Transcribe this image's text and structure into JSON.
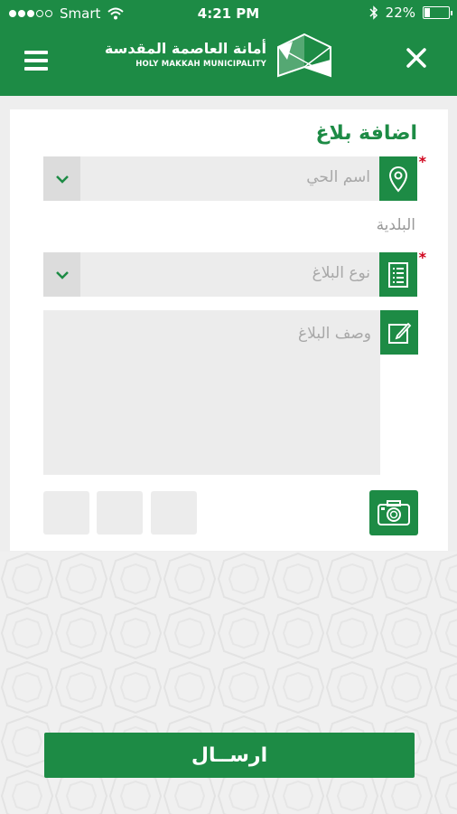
{
  "status_bar": {
    "carrier": "Smart",
    "time": "4:21 PM",
    "battery": "22%",
    "battery_level": 0.22
  },
  "header": {
    "logo_arabic": "أمانة العاصمة المقدسة",
    "logo_english": "HOLY MAKKAH MUNICIPALITY",
    "menu_icon": "hamburger-icon",
    "close_icon": "close-icon"
  },
  "form": {
    "title": "اضافة بلاغ",
    "neighborhood_placeholder": "اسم الحي",
    "municipality_label": "البلدية",
    "report_type_placeholder": "نوع البلاغ",
    "description_placeholder": "وصف البلاغ",
    "required_mark": "*"
  },
  "submit_label": "ارســال",
  "colors": {
    "primary": "#1d8b45",
    "required": "#d0021b",
    "field_bg": "#ececec"
  }
}
